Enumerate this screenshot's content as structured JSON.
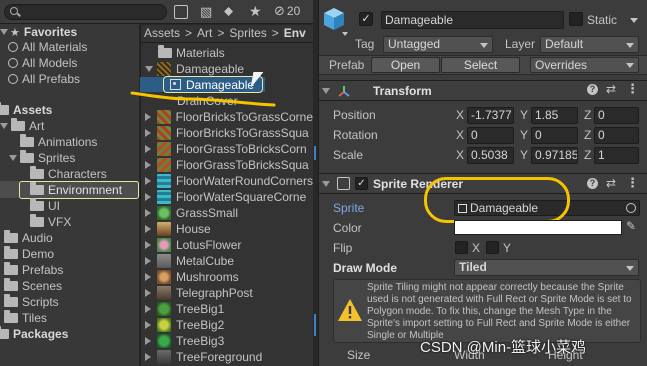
{
  "left_panel": {
    "search_placeholder": "",
    "hidden_count": "20",
    "favorites_label": "Favorites",
    "favorites": [
      "All Materials",
      "All Models",
      "All Prefabs"
    ],
    "assets_label": "Assets",
    "tree": [
      "Art",
      "Animations",
      "Sprites",
      "Characters",
      "Environmnent",
      "UI",
      "VFX",
      "Audio",
      "Demo",
      "Prefabs",
      "Scenes",
      "Scripts",
      "Tiles"
    ],
    "packages_label": "Packages"
  },
  "middle_panel": {
    "breadcrumb": [
      "Assets",
      "Art",
      "Sprites",
      "Env"
    ],
    "items": [
      "Materials",
      "Damageable",
      "Damageable",
      "DrainCover",
      "FloorBricksToGrassCorne",
      "FloorBricksToGrassSqua",
      "FloorGrassToBricksCorn",
      "FloorGrassToBricksSqua",
      "FloorWaterRoundCorners",
      "FloorWaterSquareCorne",
      "GrassSmall",
      "House",
      "LotusFlower",
      "MetalCube",
      "Mushrooms",
      "TelegraphPost",
      "TreeBig1",
      "TreeBig2",
      "TreeBig3",
      "TreeForeground"
    ]
  },
  "inspector": {
    "object_name": "Damageable",
    "static_label": "Static",
    "tag_label": "Tag",
    "tag_value": "Untagged",
    "layer_label": "Layer",
    "layer_value": "Default",
    "prefab_label": "Prefab",
    "open_label": "Open",
    "select_label": "Select",
    "overrides_label": "Overrides",
    "transform": {
      "title": "Transform",
      "position_label": "Position",
      "rotation_label": "Rotation",
      "scale_label": "Scale",
      "position": [
        "-1.7377",
        "1.85",
        "0"
      ],
      "rotation": [
        "0",
        "0",
        "0"
      ],
      "scale": [
        "0.5038",
        "0.97185",
        "1"
      ]
    },
    "sprite_renderer": {
      "title": "Sprite Renderer",
      "sprite_label": "Sprite",
      "sprite_value": "Damageable",
      "color_label": "Color",
      "flip_label": "Flip",
      "flip_x": "X",
      "flip_y": "Y",
      "draw_mode_label": "Draw Mode",
      "draw_mode_value": "Tiled",
      "warning": "Sprite Tiling might not appear correctly because the Sprite used is not generated with Full Rect or Sprite Mode is set to Polygon mode. To fix this, change the Mesh Type in the Sprite's import setting to Full Rect and Sprite Mode is either Single or Multiple",
      "size_label": "Size",
      "width_label": "Width",
      "height_label": "Height"
    }
  },
  "watermark": "CSDN @Min-篮球小菜鸡",
  "colors": {
    "background": "#282828",
    "panel": "#383838",
    "selection": "#2c5d87",
    "annotation": "#f5c400",
    "link_blue": "#7ea8e4"
  }
}
